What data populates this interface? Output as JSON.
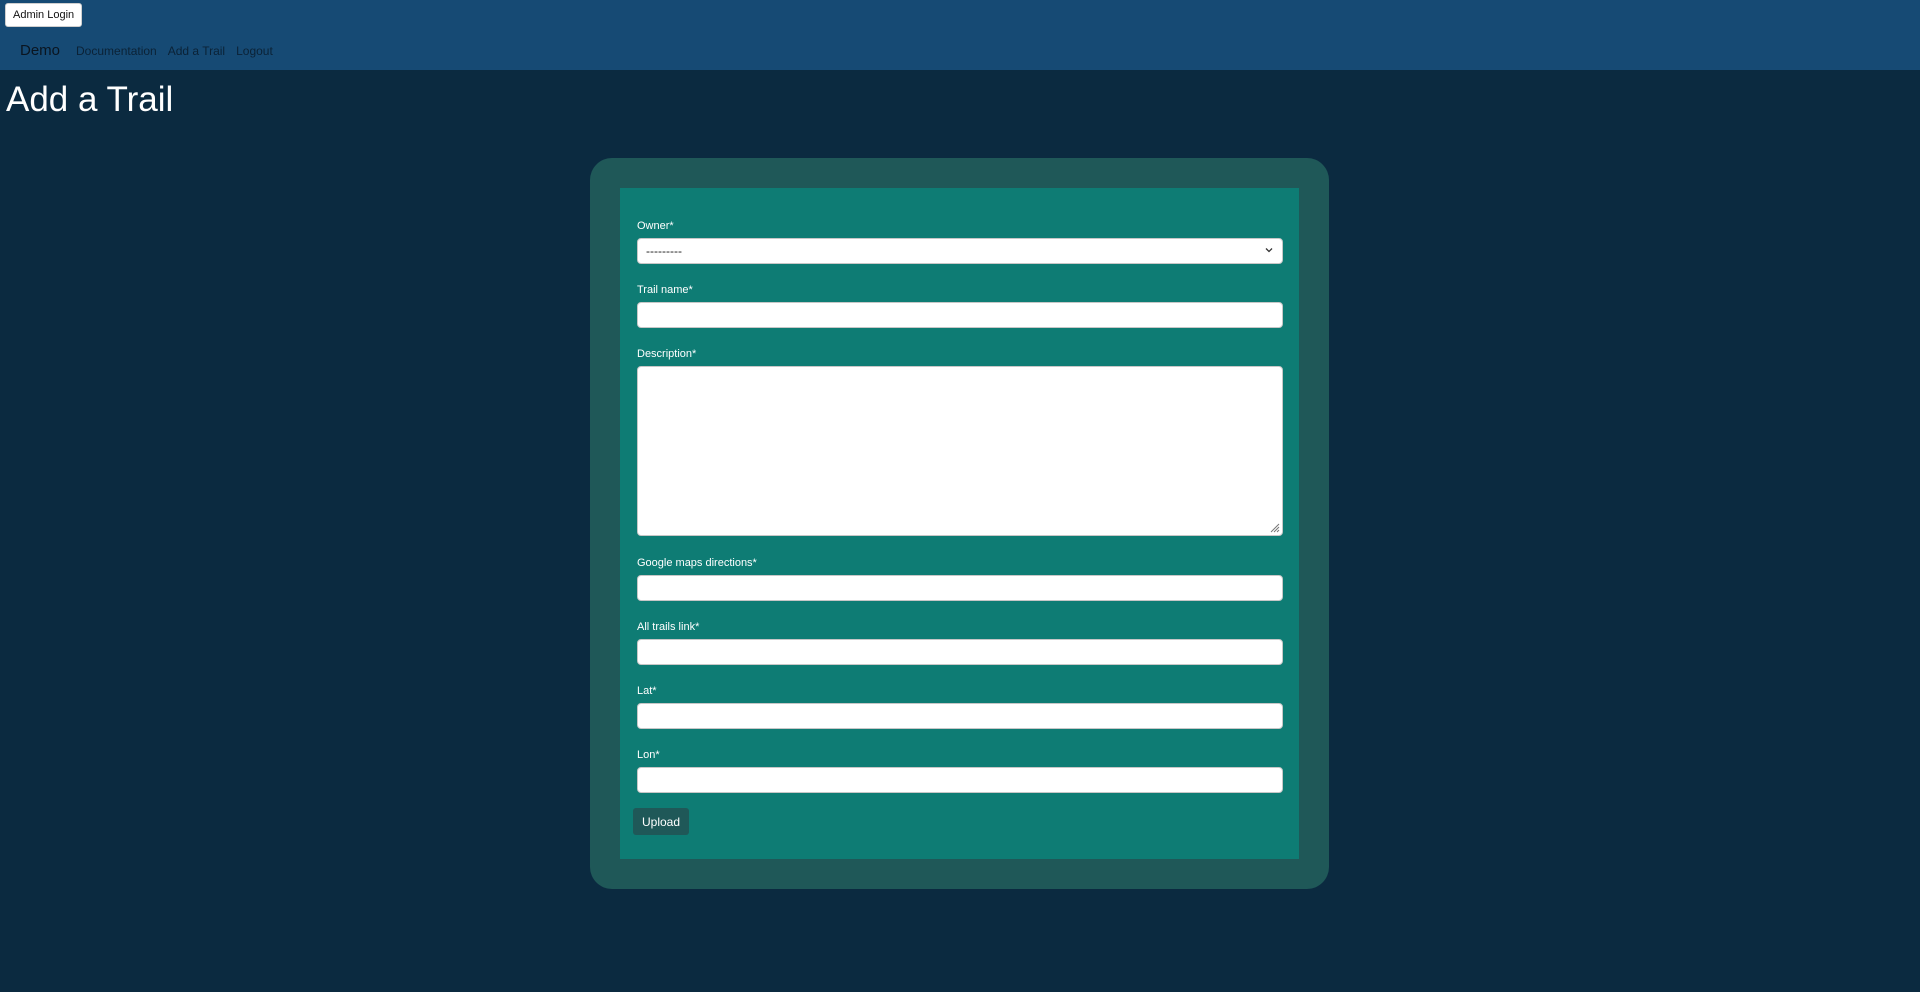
{
  "header": {
    "admin_login_label": "Admin Login",
    "brand": "Demo",
    "nav_links": [
      "Documentation",
      "Add a Trail",
      "Logout"
    ]
  },
  "page": {
    "title": "Add a Trail"
  },
  "form": {
    "owner": {
      "label": "Owner*",
      "value": "---------"
    },
    "trail_name": {
      "label": "Trail name*",
      "value": ""
    },
    "description": {
      "label": "Description*",
      "value": ""
    },
    "google_maps": {
      "label": "Google maps directions*",
      "value": ""
    },
    "all_trails": {
      "label": "All trails link*",
      "value": ""
    },
    "lat": {
      "label": "Lat*",
      "value": ""
    },
    "lon": {
      "label": "Lon*",
      "value": ""
    },
    "submit_label": "Upload"
  },
  "colors": {
    "page_background": "#0b2a40",
    "header_background": "#164a74",
    "card_outer": "#1f5858",
    "card_inner": "#0e7c74",
    "button": "#1f5858"
  },
  "icons": {
    "select_arrow": "chevron-down-icon",
    "textarea_corner": "resize-handle-icon"
  }
}
